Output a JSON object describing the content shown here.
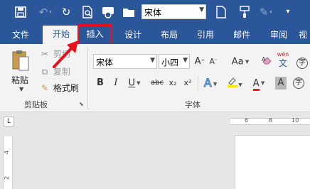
{
  "qat": {
    "font_name": "宋体",
    "icons": [
      "save-icon",
      "undo-icon",
      "redo-icon",
      "print-preview-icon",
      "touch-mode-icon",
      "open-folder-icon",
      "new-document-icon",
      "format-painter-icon",
      "customize-qat-icon"
    ]
  },
  "tabs": [
    {
      "label": "文件"
    },
    {
      "label": "开始"
    },
    {
      "label": "插入"
    },
    {
      "label": "设计"
    },
    {
      "label": "布局"
    },
    {
      "label": "引用"
    },
    {
      "label": "邮件"
    },
    {
      "label": "审阅"
    },
    {
      "label": "视"
    }
  ],
  "active_tab": "开始",
  "highlighted_tab": "插入",
  "clipboard": {
    "paste": "粘贴",
    "cut": "剪切",
    "copy": "复制",
    "format_painter": "格式刷",
    "group_label": "剪贴板"
  },
  "font": {
    "font_name": "宋体",
    "font_size": "小四",
    "change_case": "Aa",
    "clear_format": "",
    "phonetic": "wén",
    "bold": "B",
    "italic": "I",
    "underline": "U",
    "strikethrough": "abc",
    "subscript": "x₂",
    "superscript": "x²",
    "font_color": "A",
    "char_shading": "A",
    "group_label": "字体"
  },
  "ruler": {
    "corner": "L",
    "h_ticks": [
      "6",
      "8",
      "10"
    ],
    "v_ticks": [
      "4",
      "2"
    ]
  },
  "colors": {
    "ribbon_blue": "#2b579a",
    "highlight_red": "#e8101a",
    "font_color_bar": "#e02020",
    "highlight_yellow": "#ffe800"
  }
}
